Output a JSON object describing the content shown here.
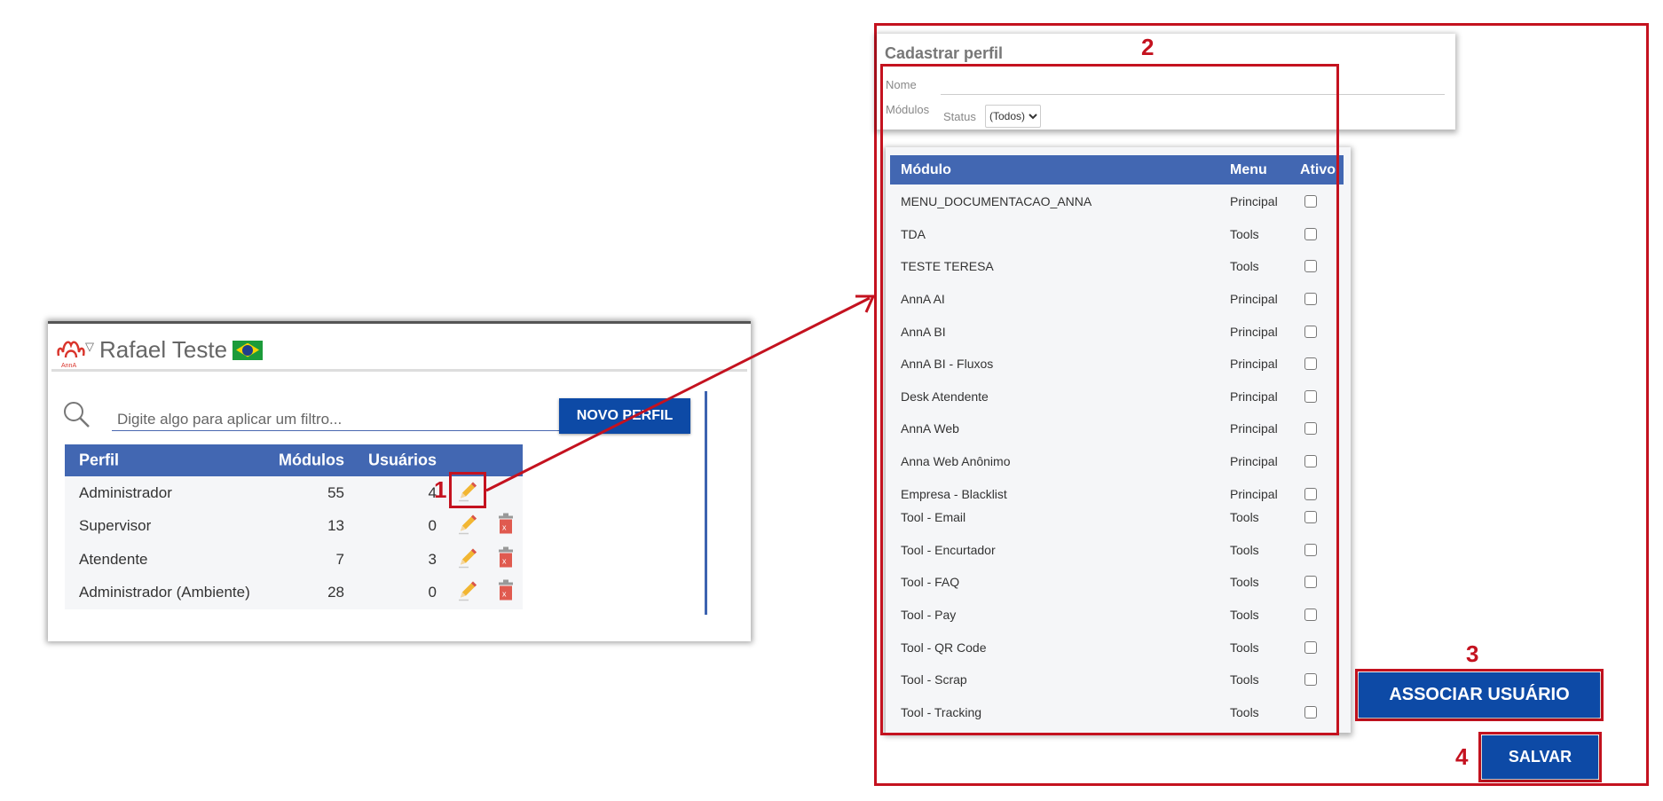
{
  "left_panel": {
    "logo_text": "AnnA",
    "user_name": "Rafael Teste",
    "flag_icon": "brazil-flag",
    "search": {
      "placeholder": "Digite algo para aplicar um filtro...",
      "value": ""
    },
    "new_profile_label": "NOVO PERFIL",
    "table": {
      "headers": [
        "Perfil",
        "Módulos",
        "Usuários"
      ],
      "rows": [
        {
          "perfil": "Administrador",
          "modulos": "55",
          "usuarios": "4",
          "deletable": false
        },
        {
          "perfil": "Supervisor",
          "modulos": "13",
          "usuarios": "0",
          "deletable": true
        },
        {
          "perfil": "Atendente",
          "modulos": "7",
          "usuarios": "3",
          "deletable": true
        },
        {
          "perfil": "Administrador (Ambiente)",
          "modulos": "28",
          "usuarios": "0",
          "deletable": true
        }
      ]
    }
  },
  "annotations": {
    "step1": "1",
    "step2": "2",
    "step3": "3",
    "step4": "4",
    "color": "#c4121f"
  },
  "form": {
    "title": "Cadastrar perfil",
    "nome_label": "Nome",
    "nome_value": "",
    "modulos_label": "Módulos",
    "status_label": "Status",
    "status_selected": "(Todos)"
  },
  "modules_table": {
    "headers": [
      "Módulo",
      "Menu",
      "Ativo"
    ],
    "rows": [
      {
        "modulo": "MENU_DOCUMENTACAO_ANNA",
        "menu": "Principal",
        "ativo": false
      },
      {
        "modulo": "TDA",
        "menu": "Tools",
        "ativo": false
      },
      {
        "modulo": "TESTE TERESA",
        "menu": "Tools",
        "ativo": false
      },
      {
        "modulo": "AnnA AI",
        "menu": "Principal",
        "ativo": false
      },
      {
        "modulo": "AnnA BI",
        "menu": "Principal",
        "ativo": false
      },
      {
        "modulo": "AnnA BI - Fluxos",
        "menu": "Principal",
        "ativo": false
      },
      {
        "modulo": "Desk Atendente",
        "menu": "Principal",
        "ativo": false
      },
      {
        "modulo": "AnnA Web",
        "menu": "Principal",
        "ativo": false
      },
      {
        "modulo": "Anna Web Anônimo",
        "menu": "Principal",
        "ativo": false
      },
      {
        "modulo": "Empresa - Blacklist",
        "menu": "Principal",
        "ativo": false
      },
      {
        "modulo": "Tool - Email",
        "menu": "Tools",
        "ativo": false
      },
      {
        "modulo": "Tool - Encurtador",
        "menu": "Tools",
        "ativo": false
      },
      {
        "modulo": "Tool - FAQ",
        "menu": "Tools",
        "ativo": false
      },
      {
        "modulo": "Tool - Pay",
        "menu": "Tools",
        "ativo": false
      },
      {
        "modulo": "Tool - QR Code",
        "menu": "Tools",
        "ativo": false
      },
      {
        "modulo": "Tool - Scrap",
        "menu": "Tools",
        "ativo": false
      },
      {
        "modulo": "Tool - Tracking",
        "menu": "Tools",
        "ativo": false
      }
    ]
  },
  "buttons": {
    "associar": "ASSOCIAR USUÁRIO",
    "salvar": "SALVAR"
  },
  "colors": {
    "header_blue": "#4267b2",
    "button_blue": "#0d4aa6",
    "highlight_red": "#c4121f"
  }
}
